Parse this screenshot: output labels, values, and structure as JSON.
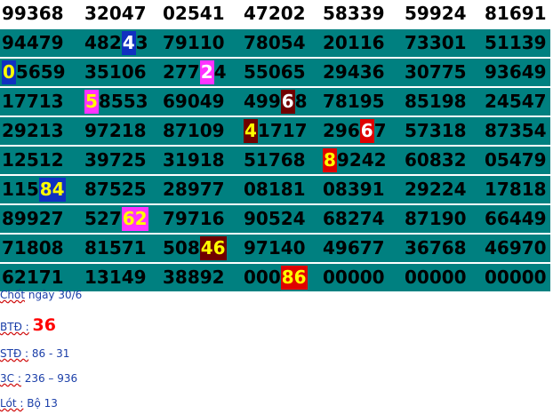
{
  "colors": {
    "row_bg": "#008080",
    "first_row_bg": "#ffffff",
    "digit_text": "#000000",
    "note_text": "#1a3ea8",
    "accent_red": "#ff0000"
  },
  "rows": [
    [
      "99368",
      "32047",
      "02541",
      "47202",
      "58339",
      "59924",
      "81691"
    ],
    [
      "94479",
      "48243",
      "79110",
      "78054",
      "20116",
      "73301",
      "51139"
    ],
    [
      "05659",
      "35106",
      "27724",
      "55065",
      "29436",
      "30775",
      "93649"
    ],
    [
      "17713",
      "58553",
      "69049",
      "49968",
      "78195",
      "85198",
      "24547"
    ],
    [
      "29213",
      "97218",
      "87109",
      "41717",
      "29667",
      "57318",
      "87354"
    ],
    [
      "12512",
      "39725",
      "31918",
      "51768",
      "89242",
      "60832",
      "05479"
    ],
    [
      "11584",
      "87525",
      "28977",
      "08181",
      "08391",
      "29224",
      "17818"
    ],
    [
      "89927",
      "52762",
      "79716",
      "90524",
      "68274",
      "87190",
      "66449"
    ],
    [
      "71808",
      "81571",
      "50846",
      "97140",
      "49677",
      "36768",
      "46970"
    ],
    [
      "62171",
      "13149",
      "38892",
      "00086",
      "00000",
      "00000",
      "00000"
    ]
  ],
  "highlights": [
    {
      "row": 1,
      "col": 1,
      "start": 3,
      "len": 1,
      "bg": "#1030c0",
      "fg": "#ffffff"
    },
    {
      "row": 2,
      "col": 0,
      "start": 0,
      "len": 1,
      "bg": "#1030c0",
      "fg": "#ffff00"
    },
    {
      "row": 2,
      "col": 2,
      "start": 3,
      "len": 1,
      "bg": "#ff33ff",
      "fg": "#ffffff"
    },
    {
      "row": 3,
      "col": 1,
      "start": 0,
      "len": 1,
      "bg": "#ff33ff",
      "fg": "#ffff00"
    },
    {
      "row": 3,
      "col": 3,
      "start": 3,
      "len": 1,
      "bg": "#700000",
      "fg": "#ffffff"
    },
    {
      "row": 4,
      "col": 3,
      "start": 0,
      "len": 1,
      "bg": "#700000",
      "fg": "#ffff00"
    },
    {
      "row": 4,
      "col": 4,
      "start": 3,
      "len": 1,
      "bg": "#e00000",
      "fg": "#ffffff"
    },
    {
      "row": 5,
      "col": 4,
      "start": 0,
      "len": 1,
      "bg": "#e00000",
      "fg": "#ffff00"
    },
    {
      "row": 6,
      "col": 0,
      "start": 3,
      "len": 2,
      "bg": "#1030c0",
      "fg": "#ffff00"
    },
    {
      "row": 7,
      "col": 1,
      "start": 3,
      "len": 2,
      "bg": "#ff33ff",
      "fg": "#ffff00"
    },
    {
      "row": 8,
      "col": 2,
      "start": 3,
      "len": 2,
      "bg": "#700000",
      "fg": "#ffff00"
    },
    {
      "row": 9,
      "col": 3,
      "start": 3,
      "len": 2,
      "bg": "#e00000",
      "fg": "#ffff00"
    }
  ],
  "notes": {
    "chot_label": "Chốt",
    "chot_rest": " ngày 30/6",
    "btd_label": "BTĐ :",
    "btd_value": "36",
    "std_label": "STĐ :",
    "std_value": " 86 - 31",
    "c3_label": "3C :",
    "c3_value": " 236 – 936",
    "lot_label": "Lót :",
    "lot_value": " Bộ 13"
  }
}
